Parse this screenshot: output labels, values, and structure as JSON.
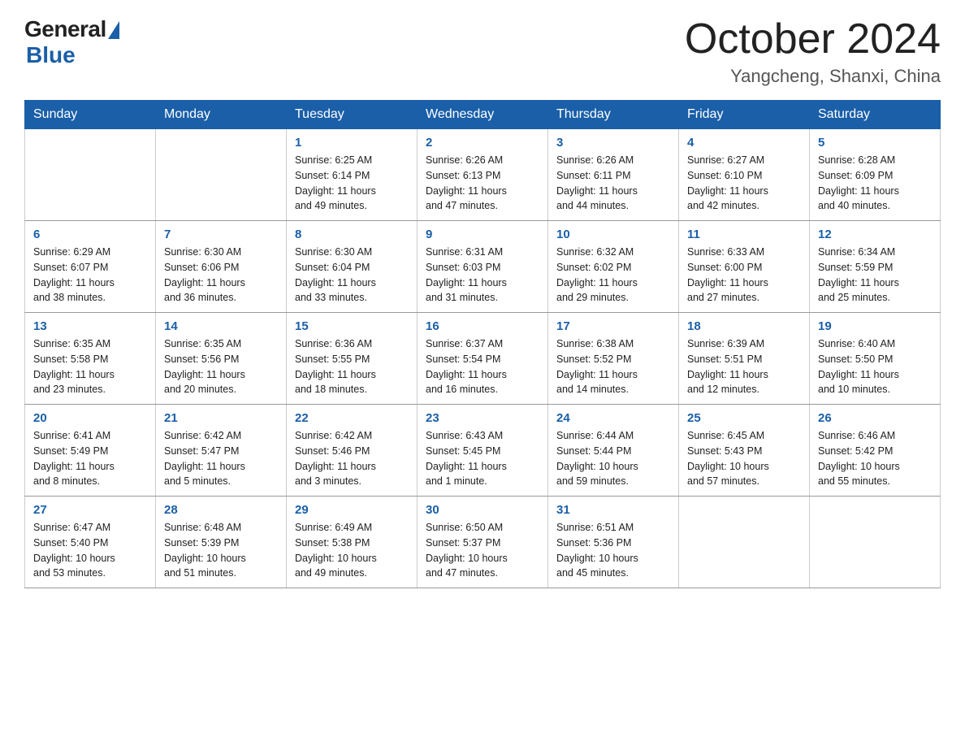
{
  "header": {
    "logo_general": "General",
    "logo_blue": "Blue",
    "month_title": "October 2024",
    "location": "Yangcheng, Shanxi, China"
  },
  "days_of_week": [
    "Sunday",
    "Monday",
    "Tuesday",
    "Wednesday",
    "Thursday",
    "Friday",
    "Saturday"
  ],
  "weeks": [
    [
      {
        "day": "",
        "info": ""
      },
      {
        "day": "",
        "info": ""
      },
      {
        "day": "1",
        "info": "Sunrise: 6:25 AM\nSunset: 6:14 PM\nDaylight: 11 hours\nand 49 minutes."
      },
      {
        "day": "2",
        "info": "Sunrise: 6:26 AM\nSunset: 6:13 PM\nDaylight: 11 hours\nand 47 minutes."
      },
      {
        "day": "3",
        "info": "Sunrise: 6:26 AM\nSunset: 6:11 PM\nDaylight: 11 hours\nand 44 minutes."
      },
      {
        "day": "4",
        "info": "Sunrise: 6:27 AM\nSunset: 6:10 PM\nDaylight: 11 hours\nand 42 minutes."
      },
      {
        "day": "5",
        "info": "Sunrise: 6:28 AM\nSunset: 6:09 PM\nDaylight: 11 hours\nand 40 minutes."
      }
    ],
    [
      {
        "day": "6",
        "info": "Sunrise: 6:29 AM\nSunset: 6:07 PM\nDaylight: 11 hours\nand 38 minutes."
      },
      {
        "day": "7",
        "info": "Sunrise: 6:30 AM\nSunset: 6:06 PM\nDaylight: 11 hours\nand 36 minutes."
      },
      {
        "day": "8",
        "info": "Sunrise: 6:30 AM\nSunset: 6:04 PM\nDaylight: 11 hours\nand 33 minutes."
      },
      {
        "day": "9",
        "info": "Sunrise: 6:31 AM\nSunset: 6:03 PM\nDaylight: 11 hours\nand 31 minutes."
      },
      {
        "day": "10",
        "info": "Sunrise: 6:32 AM\nSunset: 6:02 PM\nDaylight: 11 hours\nand 29 minutes."
      },
      {
        "day": "11",
        "info": "Sunrise: 6:33 AM\nSunset: 6:00 PM\nDaylight: 11 hours\nand 27 minutes."
      },
      {
        "day": "12",
        "info": "Sunrise: 6:34 AM\nSunset: 5:59 PM\nDaylight: 11 hours\nand 25 minutes."
      }
    ],
    [
      {
        "day": "13",
        "info": "Sunrise: 6:35 AM\nSunset: 5:58 PM\nDaylight: 11 hours\nand 23 minutes."
      },
      {
        "day": "14",
        "info": "Sunrise: 6:35 AM\nSunset: 5:56 PM\nDaylight: 11 hours\nand 20 minutes."
      },
      {
        "day": "15",
        "info": "Sunrise: 6:36 AM\nSunset: 5:55 PM\nDaylight: 11 hours\nand 18 minutes."
      },
      {
        "day": "16",
        "info": "Sunrise: 6:37 AM\nSunset: 5:54 PM\nDaylight: 11 hours\nand 16 minutes."
      },
      {
        "day": "17",
        "info": "Sunrise: 6:38 AM\nSunset: 5:52 PM\nDaylight: 11 hours\nand 14 minutes."
      },
      {
        "day": "18",
        "info": "Sunrise: 6:39 AM\nSunset: 5:51 PM\nDaylight: 11 hours\nand 12 minutes."
      },
      {
        "day": "19",
        "info": "Sunrise: 6:40 AM\nSunset: 5:50 PM\nDaylight: 11 hours\nand 10 minutes."
      }
    ],
    [
      {
        "day": "20",
        "info": "Sunrise: 6:41 AM\nSunset: 5:49 PM\nDaylight: 11 hours\nand 8 minutes."
      },
      {
        "day": "21",
        "info": "Sunrise: 6:42 AM\nSunset: 5:47 PM\nDaylight: 11 hours\nand 5 minutes."
      },
      {
        "day": "22",
        "info": "Sunrise: 6:42 AM\nSunset: 5:46 PM\nDaylight: 11 hours\nand 3 minutes."
      },
      {
        "day": "23",
        "info": "Sunrise: 6:43 AM\nSunset: 5:45 PM\nDaylight: 11 hours\nand 1 minute."
      },
      {
        "day": "24",
        "info": "Sunrise: 6:44 AM\nSunset: 5:44 PM\nDaylight: 10 hours\nand 59 minutes."
      },
      {
        "day": "25",
        "info": "Sunrise: 6:45 AM\nSunset: 5:43 PM\nDaylight: 10 hours\nand 57 minutes."
      },
      {
        "day": "26",
        "info": "Sunrise: 6:46 AM\nSunset: 5:42 PM\nDaylight: 10 hours\nand 55 minutes."
      }
    ],
    [
      {
        "day": "27",
        "info": "Sunrise: 6:47 AM\nSunset: 5:40 PM\nDaylight: 10 hours\nand 53 minutes."
      },
      {
        "day": "28",
        "info": "Sunrise: 6:48 AM\nSunset: 5:39 PM\nDaylight: 10 hours\nand 51 minutes."
      },
      {
        "day": "29",
        "info": "Sunrise: 6:49 AM\nSunset: 5:38 PM\nDaylight: 10 hours\nand 49 minutes."
      },
      {
        "day": "30",
        "info": "Sunrise: 6:50 AM\nSunset: 5:37 PM\nDaylight: 10 hours\nand 47 minutes."
      },
      {
        "day": "31",
        "info": "Sunrise: 6:51 AM\nSunset: 5:36 PM\nDaylight: 10 hours\nand 45 minutes."
      },
      {
        "day": "",
        "info": ""
      },
      {
        "day": "",
        "info": ""
      }
    ]
  ]
}
